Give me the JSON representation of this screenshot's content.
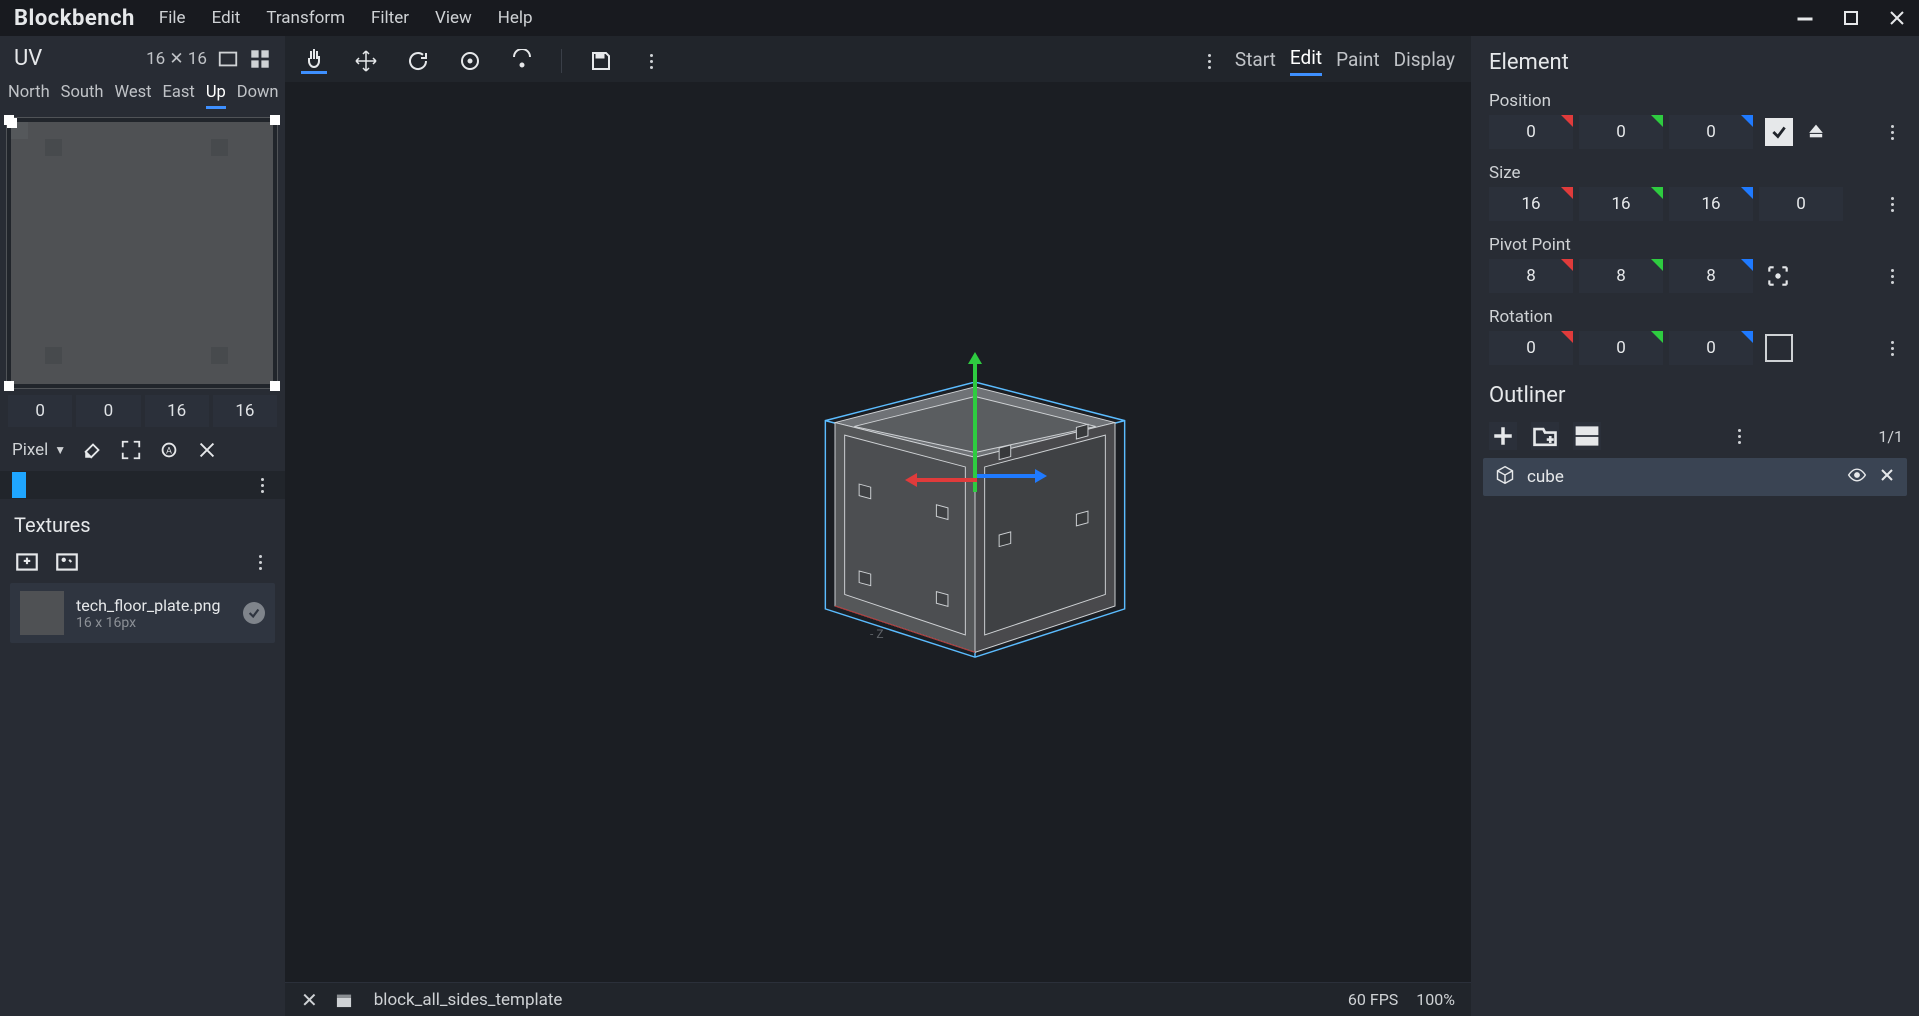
{
  "app": {
    "title": "Blockbench"
  },
  "menu": [
    "File",
    "Edit",
    "Transform",
    "Filter",
    "View",
    "Help"
  ],
  "modes": {
    "items": [
      "Start",
      "Edit",
      "Paint",
      "Display"
    ],
    "active": "Edit"
  },
  "uv": {
    "title": "UV",
    "size": "16 ✕ 16",
    "faces": [
      "North",
      "South",
      "West",
      "East",
      "Up",
      "Down"
    ],
    "active_face": "Up",
    "coords": [
      "0",
      "0",
      "16",
      "16"
    ],
    "brush_mode": "Pixel"
  },
  "textures": {
    "title": "Textures",
    "items": [
      {
        "name": "tech_floor_plate.png",
        "dim": "16 x 16px"
      }
    ]
  },
  "element": {
    "title": "Element",
    "position": {
      "label": "Position",
      "x": "0",
      "y": "0",
      "z": "0",
      "checked": true
    },
    "size": {
      "label": "Size",
      "x": "16",
      "y": "16",
      "z": "16",
      "w": "0"
    },
    "pivot": {
      "label": "Pivot Point",
      "x": "8",
      "y": "8",
      "z": "8"
    },
    "rotation": {
      "label": "Rotation",
      "x": "0",
      "y": "0",
      "z": "0",
      "checked": false
    }
  },
  "outliner": {
    "title": "Outliner",
    "count": "1/1",
    "items": [
      {
        "name": "cube"
      }
    ]
  },
  "status": {
    "project": "block_all_sides_template",
    "fps": "60 FPS",
    "zoom": "100%"
  }
}
